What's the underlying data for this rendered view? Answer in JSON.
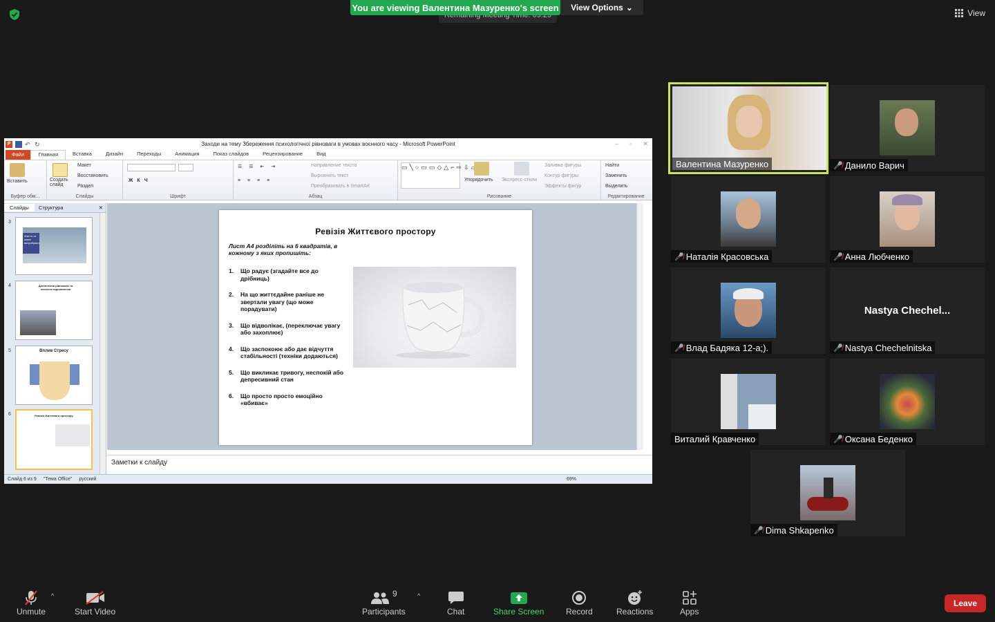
{
  "meeting": {
    "banner": "You are viewing Валентина Мазуренко's screen",
    "remaining": "Remaining Meeting Time: 09:29",
    "view_options": "View Options",
    "view": "View"
  },
  "ppt": {
    "title": "Заходи на тему Збереження психологічної рівноваги в умовах воєнного часу - Microsoft PowerPoint",
    "file_tab": "Файл",
    "tabs": [
      "Главная",
      "Вставка",
      "Дизайн",
      "Переходы",
      "Анимация",
      "Показ слайдов",
      "Рецензирование",
      "Вид"
    ],
    "ribbon": {
      "paste": "Вставить",
      "create_slide": "Создать слайд",
      "layout": "Макет",
      "reset": "Восстановить",
      "section": "Раздел",
      "text_direction": "Направление текста",
      "align_text": "Выровнять текст",
      "smartart": "Преобразовать в SmartArt",
      "arrange": "Упорядочить",
      "quick_styles": "Экспресс-стили",
      "fill": "Заливка фигуры",
      "outline": "Контур фигуры",
      "effects": "Эффекты фигур",
      "find": "Найти",
      "replace": "Заменить",
      "select": "Выделить",
      "groups": [
        "Буфер обм...",
        "Слайды",
        "Шрифт",
        "Абзац",
        "Рисование",
        "Редактирование"
      ]
    },
    "pane_tabs": [
      "Слайды",
      "Структура"
    ],
    "thumbs": [
      {
        "num": "3",
        "text": "Життя-та кожні випробування"
      },
      {
        "num": "4",
        "text": "Досягнення рівноваги та психічне відновлення"
      },
      {
        "num": "5",
        "text": "Вплив Стресу"
      },
      {
        "num": "6",
        "text": "Ревізія Життєвого простору"
      }
    ],
    "slide": {
      "title": "Ревізія Життєвого простору",
      "intro": "Лист А4 розділіть на 6 квадратів, в кожному з яких пропишіть:",
      "items": [
        {
          "n": "1.",
          "text": "Що радує (згадайте все до дрібниць)"
        },
        {
          "n": "2.",
          "text": "На що життєдайне раніше не звертали увагу (що може порадувати)"
        },
        {
          "n": "3.",
          "text": "Що відволікає, (переключає увагу або захоплює)"
        },
        {
          "n": "4.",
          "text": "Що заспокоює або дає відчуття стабільності (техніки додаються)"
        },
        {
          "n": "5.",
          "text": "Що викликає тривогу, неспокій або депресивний стан"
        },
        {
          "n": "6.",
          "text": "Що просто просто емоційно «вбиває»"
        }
      ]
    },
    "notes": "Заметки к слайду",
    "status": {
      "slide": "Слайд 6 из 9",
      "theme": "\"Тема Office\"",
      "lang": "русский",
      "zoom": "69%"
    }
  },
  "participants": [
    {
      "name": "Валентина Мазуренко",
      "muted": false,
      "active": true,
      "photo": "#8a7a6a"
    },
    {
      "name": "Данило Варич",
      "muted": true,
      "active": false,
      "photo": "#6a7a55"
    },
    {
      "name": "Наталія Красовська",
      "muted": true,
      "active": false,
      "photo": "#7d8a9a"
    },
    {
      "name": "Анна Любченко",
      "muted": true,
      "active": false,
      "photo": "#a8907e"
    },
    {
      "name": "Влад Бадяка 12-а;).",
      "muted": true,
      "active": false,
      "photo": "#4a6a8a"
    },
    {
      "name": "Nastya Chechelnitska",
      "muted": true,
      "active": false,
      "bigname": "Nastya  Chechel..."
    },
    {
      "name": "Виталий Кравченко",
      "muted": false,
      "active": false,
      "photo": "#8aa0b8"
    },
    {
      "name": "Оксана Беденко",
      "muted": true,
      "active": false,
      "photo": "#7a5a4a"
    },
    {
      "name": "Dima Shkapenko",
      "muted": true,
      "active": false,
      "photo": "#5a4a4a"
    }
  ],
  "toolbar": {
    "unmute": "Unmute",
    "start_video": "Start Video",
    "participants": "Participants",
    "participants_count": "9",
    "chat": "Chat",
    "share_screen": "Share Screen",
    "record": "Record",
    "reactions": "Reactions",
    "apps": "Apps",
    "leave": "Leave"
  },
  "colors": {
    "share_green": "#23a74f",
    "active_border": "#c7e55d",
    "leave_red": "#c62828",
    "muted_red": "#e53935"
  }
}
